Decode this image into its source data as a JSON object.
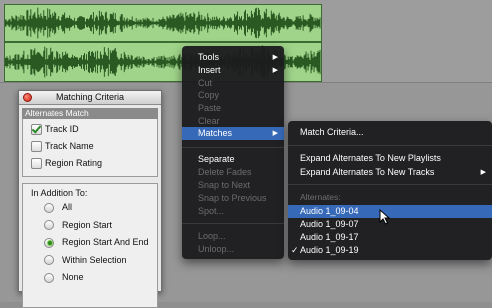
{
  "matching_criteria": {
    "title": "Matching Criteria",
    "alternates_header": "Alternates Match",
    "checkboxes": [
      {
        "label": "Track ID",
        "checked": true
      },
      {
        "label": "Track Name",
        "checked": false
      },
      {
        "label": "Region Rating",
        "checked": false
      }
    ],
    "in_addition_label": "In Addition To:",
    "radios": [
      {
        "label": "All",
        "selected": false
      },
      {
        "label": "Region Start",
        "selected": false
      },
      {
        "label": "Region Start And End",
        "selected": true
      },
      {
        "label": "Within Selection",
        "selected": false
      },
      {
        "label": "None",
        "selected": false
      }
    ]
  },
  "context_menu": {
    "items": [
      {
        "label": "Tools",
        "submenu": true,
        "disabled": false
      },
      {
        "label": "Insert",
        "submenu": true,
        "disabled": false
      },
      {
        "label": "Cut",
        "disabled": true
      },
      {
        "label": "Copy",
        "disabled": true
      },
      {
        "label": "Paste",
        "disabled": true
      },
      {
        "label": "Clear",
        "disabled": true
      },
      {
        "label": "Matches",
        "submenu": true,
        "disabled": false,
        "active": true
      },
      {
        "label": "Separate",
        "disabled": false
      },
      {
        "label": "Delete Fades",
        "disabled": true
      },
      {
        "label": "Snap to Next",
        "disabled": true
      },
      {
        "label": "Snap to Previous",
        "disabled": true
      },
      {
        "label": "Spot...",
        "disabled": true
      },
      {
        "label": "Loop...",
        "disabled": true
      },
      {
        "label": "Unloop...",
        "disabled": true
      }
    ]
  },
  "matches_submenu": {
    "match_criteria": "Match Criteria...",
    "expand_playlists": "Expand Alternates To New Playlists",
    "expand_tracks": "Expand Alternates To New Tracks",
    "alternates_header": "Alternates:",
    "alternates": [
      {
        "label": "Audio 1_09-04",
        "highlighted": true,
        "checked": false
      },
      {
        "label": "Audio 1_09-07",
        "highlighted": false,
        "checked": false
      },
      {
        "label": "Audio 1_09-17",
        "highlighted": false,
        "checked": false
      },
      {
        "label": "Audio 1_09-19",
        "highlighted": false,
        "checked": true
      }
    ]
  },
  "colors": {
    "clip_fill": "#9fd48a",
    "waveform": "#2a5a22",
    "menu_bg": "#1c1c1e",
    "menu_highlight": "#3669b8",
    "radio_selected": "#2c8a1e"
  }
}
